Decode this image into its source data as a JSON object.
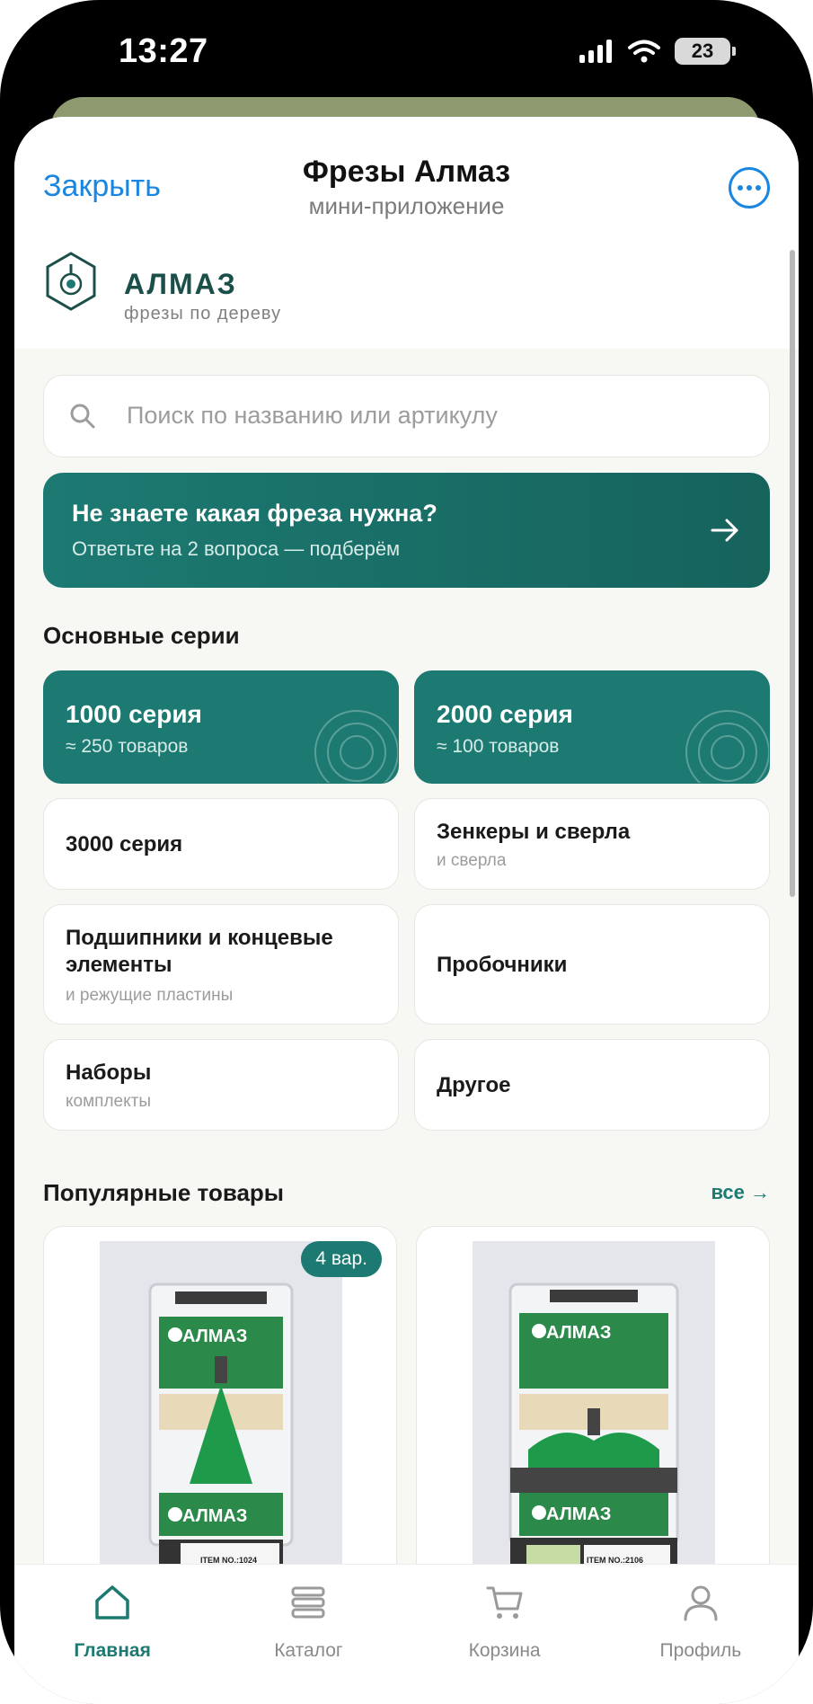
{
  "status": {
    "time": "13:27",
    "battery": "23"
  },
  "header": {
    "close_label": "Закрыть",
    "title": "Фрезы Алмаз",
    "subtitle": "мини-приложение"
  },
  "brand": {
    "name": "АЛМАЗ",
    "tagline": "фрезы по дереву"
  },
  "search": {
    "placeholder": "Поиск по названию или артикулу"
  },
  "promo": {
    "title": "Не знаете какая фреза нужна?",
    "subtitle": "Ответьте на 2 вопроса — подберём"
  },
  "series": {
    "title": "Основные серии",
    "items": [
      {
        "title": "1000 серия",
        "subtitle": "≈ 250 товаров"
      },
      {
        "title": "2000 серия",
        "subtitle": "≈ 100 товаров"
      },
      {
        "title": "3000 серия"
      },
      {
        "title": "Зенкеры и сверла",
        "subtitle": "и сверла"
      },
      {
        "title": "Подшипники и концевые элементы",
        "subtitle": "и режущие пластины"
      },
      {
        "title": "Пробочники"
      },
      {
        "title": "Наборы",
        "subtitle": "комплекты"
      },
      {
        "title": "Другое"
      }
    ]
  },
  "popular": {
    "title": "Популярные товары",
    "all_label": "все →",
    "products": [
      {
        "badge": "4 вар.",
        "brand_label": "АЛМАЗ",
        "item_no": "ITEM NO.:1024"
      },
      {
        "brand_label": "АЛМАЗ",
        "item_no": "ITEM NO.:2106"
      }
    ]
  },
  "tabs": [
    {
      "label": "Главная",
      "icon": "home-icon",
      "active": true
    },
    {
      "label": "Каталог",
      "icon": "catalog-icon"
    },
    {
      "label": "Корзина",
      "icon": "cart-icon"
    },
    {
      "label": "Профиль",
      "icon": "profile-icon"
    }
  ],
  "colors": {
    "accent": "#1c7a72",
    "link": "#1a86e0",
    "brand_text": "#1b4f49",
    "background": "#f7f7f4"
  }
}
